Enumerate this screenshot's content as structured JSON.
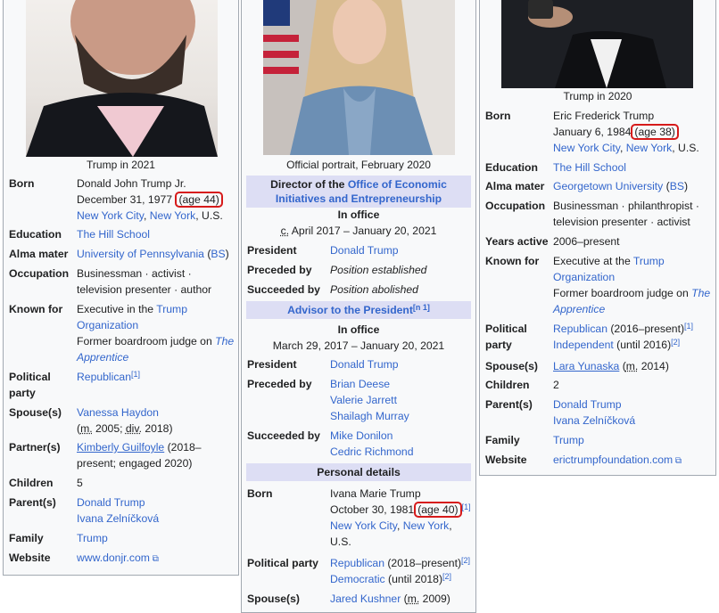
{
  "panel1": {
    "caption": "Trump in 2021",
    "rows": {
      "born": {
        "label": "Born",
        "name": "Donald John Trump Jr.",
        "date": "December 31, 1977",
        "age": "(age 44)",
        "place1": "New York City",
        "comma": ", ",
        "place2": "New York",
        "country": ", U.S."
      },
      "education": {
        "label": "Education",
        "value": "The Hill School"
      },
      "alma": {
        "label": "Alma mater",
        "link": "University of Pennsylvania",
        "degree": "BS"
      },
      "occupation": {
        "label": "Occupation",
        "line1": "Businessman · activist ·",
        "line2": "television presenter · author"
      },
      "known": {
        "label": "Known for",
        "pre": "Executive in the ",
        "link1": "Trump",
        "link2": "Organization",
        "line3a": "Former boardroom judge on ",
        "line3b": "The",
        "line4": "Apprentice"
      },
      "party": {
        "label1": "Political",
        "label2": "party",
        "value": "Republican",
        "ref": "[1]"
      },
      "spouse": {
        "label": "Spouse(s)",
        "name": "Vanessa Haydon",
        "m": "m.",
        "mtext": " 2005; ",
        "div": "div.",
        "dtext": " 2018)"
      },
      "partner": {
        "label": "Partner(s)",
        "name": "Kimberly Guilfoyle",
        "t1": " (2018–",
        "t2": "present; engaged 2020)"
      },
      "children": {
        "label": "Children",
        "value": "5"
      },
      "parents": {
        "label": "Parent(s)",
        "p1": "Donald Trump",
        "p2": "Ivana Zelníčková"
      },
      "family": {
        "label": "Family",
        "value": "Trump"
      },
      "website": {
        "label": "Website",
        "value": "www.donjr.com"
      }
    }
  },
  "panel2": {
    "caption": "Official portrait, February 2020",
    "director": {
      "pre": "Director of the ",
      "link1": "Office of Economic",
      "link2": "Initiatives and Entrepreneurship"
    },
    "inoffice1": {
      "title": "In office",
      "dates_c": "c.",
      "dates": " April 2017 – January 20, 2021"
    },
    "president1": {
      "label": "President",
      "value": "Donald Trump"
    },
    "preceded1": {
      "label": "Preceded by",
      "value": "Position established"
    },
    "succeeded1": {
      "label": "Succeeded by",
      "value": "Position abolished"
    },
    "advisor": {
      "link": "Advisor to the President",
      "ref": "[n 1]"
    },
    "inoffice2": {
      "title": "In office",
      "dates": "March 29, 2017 – January 20, 2021"
    },
    "president2": {
      "label": "President",
      "value": "Donald Trump"
    },
    "preceded2": {
      "label": "Preceded by",
      "v1": "Brian Deese",
      "v2": "Valerie Jarrett",
      "v3": "Shailagh Murray"
    },
    "succeeded2": {
      "label": "Succeeded by",
      "v1": "Mike Donilon",
      "v2": "Cedric Richmond"
    },
    "personal": "Personal details",
    "born": {
      "label": "Born",
      "name": "Ivana Marie Trump",
      "date": "October 30, 1981",
      "age": "(age 40)",
      "ref": "[1]",
      "place1": "New York City",
      "place2": "New York",
      "country": "U.S."
    },
    "party": {
      "label": "Political party",
      "v1": "Republican",
      "v1t": " (2018–present)",
      "ref1": "[2]",
      "v2": "Democratic",
      "v2t": " (until 2018)",
      "ref2": "[2]"
    },
    "spouse": {
      "label": "Spouse(s)",
      "name": "Jared Kushner",
      "m": "m.",
      "mt": " 2009)"
    }
  },
  "panel3": {
    "caption": "Trump in 2020",
    "born": {
      "label": "Born",
      "name": "Eric Frederick Trump",
      "date": "January 6, 1984",
      "age": "(age 38)",
      "place1": "New York City",
      "place2": "New York",
      "country": ", U.S."
    },
    "education": {
      "label": "Education",
      "value": "The Hill School"
    },
    "alma": {
      "label": "Alma mater",
      "link": "Georgetown University",
      "degree": "BS"
    },
    "occupation": {
      "label": "Occupation",
      "line1": "Businessman · philanthropist ·",
      "line2": "television presenter · activist"
    },
    "years": {
      "label": "Years active",
      "value": "2006–present"
    },
    "known": {
      "label": "Known for",
      "pre": "Executive at the ",
      "link1": "Trump",
      "link2": "Organization",
      "line3a": "Former boardroom judge on ",
      "line3b": "The",
      "line4": "Apprentice"
    },
    "party": {
      "label1": "Political",
      "label2": "party",
      "v1": "Republican",
      "v1t": " (2016–present)",
      "ref1": "[1]",
      "v2": "Independent",
      "v2t": " (until 2016)",
      "ref2": "[2]"
    },
    "spouse": {
      "label": "Spouse(s)",
      "name": "Lara Yunaska",
      "m": "m.",
      "mt": " 2014)"
    },
    "children": {
      "label": "Children",
      "value": "2"
    },
    "parents": {
      "label": "Parent(s)",
      "p1": "Donald Trump",
      "p2": "Ivana Zelníčková"
    },
    "family": {
      "label": "Family",
      "value": "Trump"
    },
    "website": {
      "label": "Website",
      "value": "erictrumpfoundation.com"
    }
  },
  "icons": {
    "external": "external-link-icon"
  }
}
